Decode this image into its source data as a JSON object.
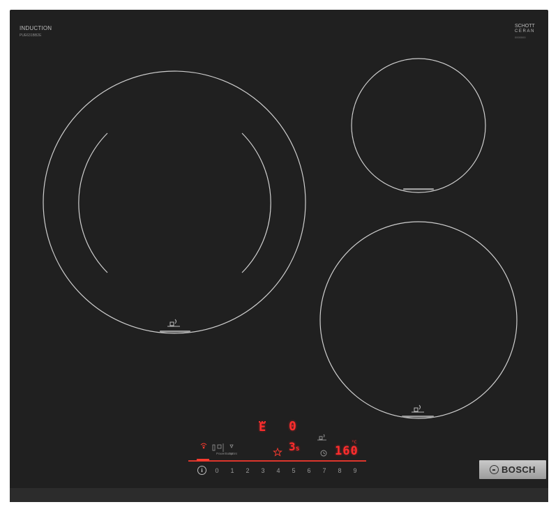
{
  "hob": {
    "label_top_left": "INDUCTION",
    "label_top_left_sub": "PUE631BB2E",
    "glass_brand": [
      "SCHOTT",
      "CERAN"
    ],
    "glass_brand_sub": "0000000",
    "brand": "BOSCH"
  },
  "zones": [
    {
      "name": "large-zone",
      "has_pan_icon": true
    },
    {
      "name": "small-zone",
      "has_pan_icon": false
    },
    {
      "name": "medium-zone",
      "has_pan_icon": true
    }
  ],
  "display": {
    "zone_power": "0",
    "timer_value": "3",
    "timer_unit": "s",
    "temperature": "160",
    "temperature_unit": "°C",
    "icon_labels": [
      "PowerBoost",
      "Sprint"
    ]
  },
  "power_scale": [
    "0",
    "1",
    "2",
    "3",
    "4",
    "5",
    "6",
    "7",
    "8",
    "9"
  ],
  "colors": {
    "glass": "#202020",
    "display_red": "#ff2d2d",
    "zone_line": "#cfcfcf",
    "logo_plate": "#b5b5b5"
  }
}
